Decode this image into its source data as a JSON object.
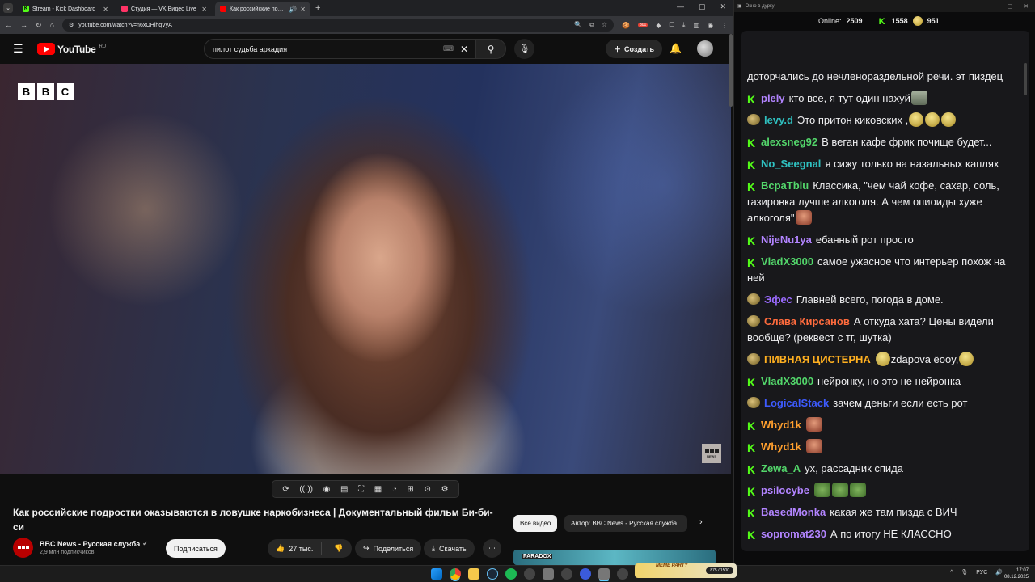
{
  "browser": {
    "tabs": [
      {
        "title": "Stream - Kick Dashboard",
        "favicon": "kick-icon",
        "color": "#53fc18",
        "active": false
      },
      {
        "title": "Студия — VK Видео Live",
        "favicon": "vk-video-icon",
        "color": "#ff3366",
        "active": false
      },
      {
        "title": "Как российские подростки оказываются в ловушке",
        "favicon": "youtube-icon",
        "color": "#ff0000",
        "active": true
      }
    ],
    "url": "youtube.com/watch?v=n6xOHlhqVyA",
    "ext_badge": "301"
  },
  "youtube": {
    "logo_text": "YouTube",
    "logo_region": "RU",
    "search_query": "пилот судьба аркадия",
    "create_label": "Создать",
    "video": {
      "title": "Как российские подростки оказываются в ловушке наркобизнеса | Документальный фильм Би-би-си",
      "watermark_letters": [
        "B",
        "B",
        "C"
      ],
      "corner_logo_text": "NEWS"
    },
    "channel": {
      "name": "BBC News - Русская служба",
      "subscribers": "2,9 млн подписчиков",
      "subscribe_label": "Подписаться"
    },
    "actions": {
      "likes": "27 тыс.",
      "share": "Поделиться",
      "download": "Скачать"
    },
    "chips": {
      "all": "Все видео",
      "author": "Автор: BBC News - Русская служба"
    },
    "rec_thumb_text": "PARADOX"
  },
  "chat_window": {
    "title": "Окно в дурку",
    "online_label": "Online:",
    "online_count": "2509",
    "kick_count": "1558",
    "other_count": "951",
    "top_fragment": "доторчались до нечленораздельной речи. эт пиздец",
    "messages": [
      {
        "badge": "kick",
        "user": "plely",
        "color": "#b284ff",
        "text": "кто все, я тут один нахуй",
        "emotes_after": [
          "trash"
        ]
      },
      {
        "badge": "knight",
        "user": "levy.d",
        "color": "#2fc0c0",
        "text": "Это притон киковских ,",
        "emotes_after": [
          "gold",
          "gold",
          "gold"
        ]
      },
      {
        "badge": "kick",
        "user": "alexsneg92",
        "color": "#53d76b",
        "text": "В веган кафе фрик почище будет...",
        "emotes_after": []
      },
      {
        "badge": "kick",
        "user": "No_Seegnal",
        "color": "#2fc0c0",
        "text": "я сижу только на назальных каплях",
        "emotes_after": []
      },
      {
        "badge": "kick",
        "user": "BcpaTblu",
        "color": "#53d76b",
        "text": "Классика, \"чем чай кофе, сахар, соль, газировка лучше алкоголя. А чем опиоиды хуже алкоголя\"",
        "emotes_after": [
          "face"
        ]
      },
      {
        "badge": "kick",
        "user": "NijeNu1ya",
        "color": "#b284ff",
        "text": "ебанный рот просто",
        "emotes_after": []
      },
      {
        "badge": "kick",
        "user": "VladX3000",
        "color": "#53d76b",
        "text": "самое ужасное что интерьер похож на ней",
        "emotes_after": []
      },
      {
        "badge": "knight",
        "user": "Эфес",
        "color": "#9b6bff",
        "text": "Главней всего, погода в доме.",
        "emotes_after": []
      },
      {
        "badge": "knight",
        "user": "Слава Кирсанов",
        "color": "#ff6b3d",
        "text": "А откуда хата? Цены видели вообще? (реквест с тг, шутка)",
        "emotes_after": []
      },
      {
        "badge": "knight",
        "user": "ПИВНАЯ ЦИСТЕРНА",
        "color": "#ffb020",
        "text": "",
        "emotes_after": [
          "gold"
        ],
        "tail": "zdapova ёooy,",
        "tail_emotes": [
          "gold"
        ]
      },
      {
        "badge": "kick",
        "user": "VladX3000",
        "color": "#53d76b",
        "text": "нейронку, но это не нейронка",
        "emotes_after": []
      },
      {
        "badge": "knight",
        "user": "LogicalStack",
        "color": "#3d5bff",
        "text": "зачем деньги если есть рот",
        "emotes_after": []
      },
      {
        "badge": "kick",
        "user": "Whyd1k",
        "color": "#ff9f2e",
        "text": "",
        "emotes_after": [
          "face"
        ]
      },
      {
        "badge": "kick",
        "user": "Whyd1k",
        "color": "#ff9f2e",
        "text": "",
        "emotes_after": [
          "face"
        ]
      },
      {
        "badge": "kick",
        "user": "Zewa_A",
        "color": "#53d76b",
        "text": "ух, рассадник спида",
        "emotes_after": []
      },
      {
        "badge": "kick",
        "user": "psilocybe",
        "color": "#b284ff",
        "text": "",
        "emotes_after": [
          "pepe",
          "pepe",
          "pepe"
        ]
      },
      {
        "badge": "kick",
        "user": "BasedMonka",
        "color": "#b284ff",
        "text": "какая же там пизда с ВИЧ",
        "emotes_after": []
      },
      {
        "badge": "kick",
        "user": "sopromat230",
        "color": "#b284ff",
        "text": "А по итогу НЕ КЛАССНО",
        "emotes_after": []
      }
    ]
  },
  "taskbar": {
    "widget_label": "MEME PARTY",
    "widget_count": "875 / 1500",
    "lang": "РУС",
    "time": "17:07",
    "date": "08.12.2025"
  }
}
